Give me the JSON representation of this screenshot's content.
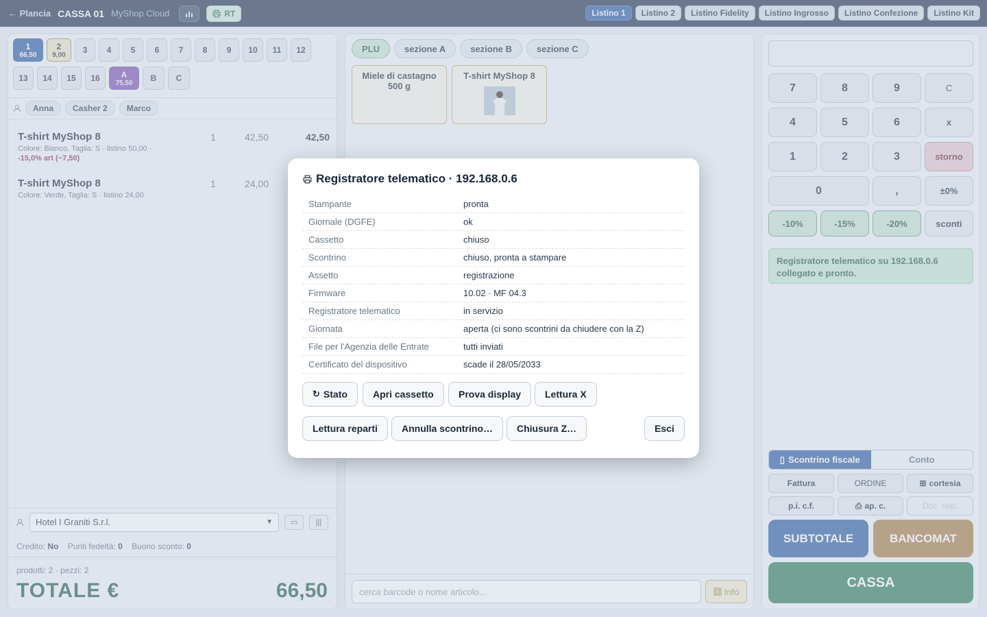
{
  "topbar": {
    "back_label": "← Plancia",
    "cassa": "CASSA 01",
    "shop": "MyShop Cloud",
    "rt_label": "RT",
    "listini": [
      "Listino 1",
      "Listino 2",
      "Listino Fidelity",
      "Listino Ingrosso",
      "Listino Confezione",
      "Listino Kit"
    ]
  },
  "tables": [
    {
      "n": "1",
      "amt": "66,50"
    },
    {
      "n": "2",
      "amt": "9,00"
    },
    {
      "n": "3"
    },
    {
      "n": "4"
    },
    {
      "n": "5"
    },
    {
      "n": "6"
    },
    {
      "n": "7"
    },
    {
      "n": "8"
    },
    {
      "n": "9"
    },
    {
      "n": "10"
    },
    {
      "n": "11"
    },
    {
      "n": "12"
    },
    {
      "n": "13"
    },
    {
      "n": "14"
    },
    {
      "n": "15"
    },
    {
      "n": "16"
    },
    {
      "n": "A",
      "amt": "75,50"
    },
    {
      "n": "B"
    },
    {
      "n": "C"
    }
  ],
  "operators": [
    "Anna",
    "Casher 2",
    "Marco"
  ],
  "lines": [
    {
      "name": "T-shirt MyShop 8",
      "detail": "Colore: Bianco, Taglia: S · listino 50,00 ·",
      "discount": "-15,0% art (−7,50)",
      "qty": "1",
      "price": "42,50",
      "total": "42,50"
    },
    {
      "name": "T-shirt MyShop 8",
      "detail": "Colore: Verde, Taglia: S · listino 24,00",
      "discount": "",
      "qty": "1",
      "price": "24,00",
      "total": ""
    }
  ],
  "customer": {
    "selected": "Hotel I Graniti S.r.l.",
    "credit_label": "Credito:",
    "credit_value": "No",
    "points_label": "Punti fedeltà:",
    "points_value": "0",
    "voucher_label": "Buono sconto:",
    "voucher_value": "0"
  },
  "totals": {
    "counts": "prodotti: 2 · pezzi: 2",
    "label": "TOTALE €",
    "value": "66,50"
  },
  "sections": [
    "PLU",
    "sezione A",
    "sezione B",
    "sezione C"
  ],
  "products": [
    {
      "name": "Miele di castagno 500 g"
    },
    {
      "name": "T-shirt MyShop 8"
    }
  ],
  "search": {
    "placeholder": "cerca barcode o nome articolo..."
  },
  "info_label": "Info",
  "keypad": {
    "keys": [
      "7",
      "8",
      "9",
      "C",
      "4",
      "5",
      "6",
      "x",
      "1",
      "2",
      "3",
      "storno",
      "0",
      ",",
      "±0%"
    ],
    "discounts": [
      "-10%",
      "-15%",
      "-20%",
      "sconti"
    ]
  },
  "rt_message": "Registratore telematico su 192.168.0.6 collegato e pronto.",
  "doc": {
    "tabs": [
      "Scontrino fiscale",
      "Conto"
    ],
    "buttons": [
      "Fattura",
      "ORDINE",
      "cortesia",
      "p.i. c.f.",
      "ap. c.",
      "Doc. riep."
    ],
    "subtotale": "SUBTOTALE",
    "bancomat": "BANCOMAT",
    "cassa": "CASSA"
  },
  "modal": {
    "title": "Registratore telematico · 192.168.0.6",
    "rows": [
      {
        "k": "Stampante",
        "v": "pronta"
      },
      {
        "k": "Giornale (DGFE)",
        "v": "ok"
      },
      {
        "k": "Cassetto",
        "v": "chiuso"
      },
      {
        "k": "Scontrino",
        "v": "chiuso, pronta a stampare"
      },
      {
        "k": "Assetto",
        "v": "registrazione"
      },
      {
        "k": "Firmware",
        "v": "10.02 · MF 04.3"
      },
      {
        "k": "Registratore telematico",
        "v": "in servizio"
      },
      {
        "k": "Giornata",
        "v": "aperta (ci sono scontrini da chiudere con la Z)"
      },
      {
        "k": "File per l'Agenzia delle Entrate",
        "v": "tutti inviati"
      },
      {
        "k": "Certificato del dispositivo",
        "v": "scade il 28/05/2033"
      }
    ],
    "buttons_row1": [
      "Stato",
      "Apri cassetto",
      "Prova display",
      "Lettura X"
    ],
    "buttons_row2": [
      "Lettura reparti",
      "Annulla scontrino…",
      "Chiusura Z…"
    ],
    "close": "Esci"
  },
  "colors": {
    "topbar": "#1f2f4c",
    "accent": "#2c5aa0",
    "total_green": "#1f5a44",
    "cassa": "#2a7a57",
    "bancomat": "#a87a42"
  }
}
